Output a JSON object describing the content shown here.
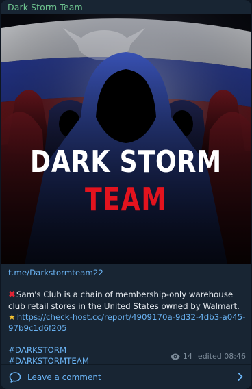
{
  "post": {
    "channel_name": "Dark Storm Team",
    "media": {
      "title_line1": "DARK STORM",
      "title_line2": "TEAM"
    },
    "link": "t.me/Darkstormteam22",
    "body": "Sam's Club is a chain of membership-only warehouse club retail stores in the United States owned by Walmart.",
    "check_link": "https://check-host.cc/report/4909170a-9d32-4db3-a045-97b9c1d6f205",
    "hashtags": [
      "#DARKSTORM",
      "#DARKSTORMTEAM"
    ],
    "views": "14",
    "edited_time": "edited 08:46"
  },
  "comments": {
    "label": "Leave a comment"
  },
  "icons": {
    "cross": "cross-mark-emoji",
    "star": "glowing-star-emoji",
    "views": "eye-icon",
    "comment": "comment-bubble-icon",
    "chevron": "chevron-right-icon"
  },
  "colors": {
    "background": "#0e1621",
    "bubble": "#182533",
    "channel_name": "#6ec48f",
    "link": "#6ab3f3",
    "accent_red": "#e02434"
  }
}
